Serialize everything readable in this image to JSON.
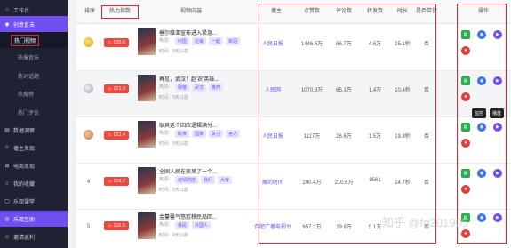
{
  "sidebar": {
    "items": [
      {
        "label": "工作台",
        "icon": "home-icon"
      },
      {
        "label": "创意直击",
        "icon": "bulb-icon"
      },
      {
        "label": "热门视频"
      },
      {
        "label": "热爆音乐"
      },
      {
        "label": "热词话题"
      },
      {
        "label": "热搜榜"
      },
      {
        "label": "热门评论"
      },
      {
        "label": "数据洞察",
        "icon": "chart-icon"
      },
      {
        "label": "播主发现",
        "icon": "user-icon"
      },
      {
        "label": "电商变现",
        "icon": "cart-icon"
      },
      {
        "label": "我的收藏",
        "icon": "star-icon"
      },
      {
        "label": "乐观课堂",
        "icon": "book-icon"
      },
      {
        "label": "乐观互助",
        "icon": "help-icon"
      },
      {
        "label": "邀请返利",
        "icon": "gift-icon"
      }
    ]
  },
  "table": {
    "headers": {
      "rank": "排序",
      "hot": "热力指数",
      "content": "视频内容",
      "owner": "播主",
      "likes": "点赞数",
      "comments": "评论数",
      "shares": "转发数",
      "duration": "时长",
      "goods": "是否带货",
      "ops": "操作"
    },
    "tag_prefix": "热词：",
    "rows": [
      {
        "rank": "1",
        "medal": "gold",
        "hot": "135.6",
        "title": "垂尔维亚宣布进入紧急...",
        "tags": [
          "中国",
          "垃圾",
          "一起",
          "新冠"
        ],
        "time": "时间：9天以前",
        "owner": "人民日报",
        "likes": "1446.6万",
        "comments": "86.7万",
        "shares": "4.6万",
        "duration": "25.1秒",
        "goods": "否"
      },
      {
        "rank": "2",
        "medal": "silver",
        "hot": "121.9",
        "title": "再见，武汉！赵'农'英雄...",
        "tags": [
          "致敬",
          "武汉",
          "离开"
        ],
        "time": "时间：9天以前",
        "owner": "人民网",
        "likes": "1070.9万",
        "comments": "65.1万",
        "shares": "1.4万",
        "duration": "10.4秒",
        "goods": "否"
      },
      {
        "rank": "3",
        "medal": "bronze",
        "hot": "121.4",
        "title": "耿爽这个回应逻辑满分...",
        "tags": [
          "耿爽",
          "国家",
          "关注",
          "官方"
        ],
        "time": "时间：9天以前",
        "owner": "人民日报",
        "likes": "1117万",
        "comments": "26.6万",
        "shares": "1.5万",
        "duration": "19.8秒",
        "goods": "否"
      },
      {
        "rank": "4",
        "medal": "",
        "hot": "119.2",
        "title": "全国人民在家呆了一个...",
        "tags": [
          "疫情防控",
          "我们",
          "大家"
        ],
        "time": "时间：9天以前",
        "owner": "摊的时间",
        "likes": "290.4万",
        "comments": "210.6万",
        "shares": "9561",
        "duration": "24.7秒",
        "goods": "否"
      },
      {
        "rank": "5",
        "medal": "",
        "hot": "116.5",
        "title": "金蔓罄气怒怼移民局回...",
        "tags": [
          "移民",
          "外国人"
        ],
        "time": "时间：9天以前",
        "owner": "合肥广播电视台",
        "likes": "657.2万",
        "comments": "29.8万",
        "shares": "5.1万",
        "duration": "",
        "goods": "否"
      }
    ]
  },
  "ops": {
    "monitor_tip": "监控",
    "play_tip": "播放"
  },
  "watermark": "知乎 @fg201905",
  "colors": {
    "accent": "#6f4ef2",
    "highlight_box": "#e0262a",
    "hot_badge": "#f0473f",
    "sidebar_bg": "#1e2233"
  }
}
